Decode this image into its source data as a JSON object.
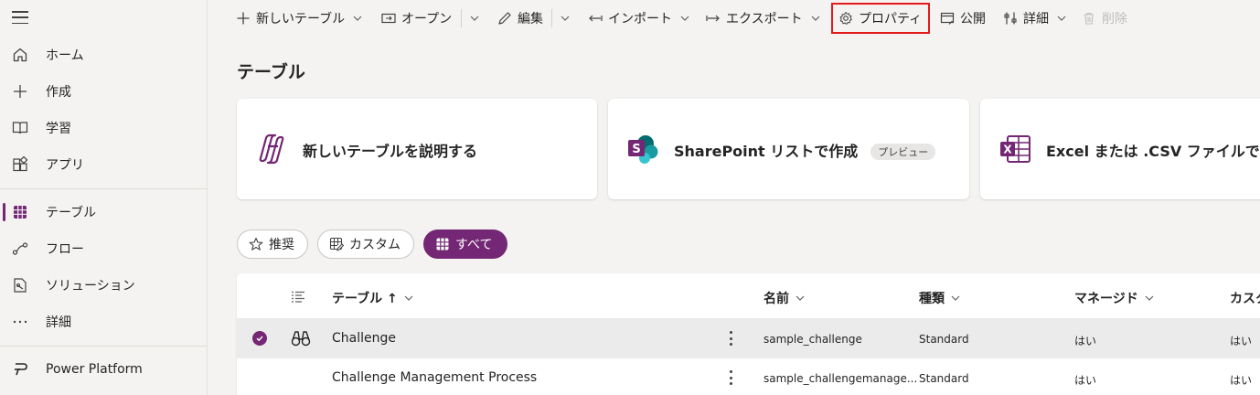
{
  "sidebar": {
    "menu_icon": "hamburger-icon",
    "items": [
      {
        "label": "ホーム",
        "icon": "home-icon"
      },
      {
        "label": "作成",
        "icon": "plus-icon"
      },
      {
        "label": "学習",
        "icon": "book-icon"
      },
      {
        "label": "アプリ",
        "icon": "apps-icon"
      },
      {
        "label": "テーブル",
        "icon": "table-icon",
        "active": true
      },
      {
        "label": "フロー",
        "icon": "flow-icon"
      },
      {
        "label": "ソリューション",
        "icon": "solution-icon"
      },
      {
        "label": "詳細",
        "icon": "more-icon"
      },
      {
        "label": "Power Platform",
        "icon": "power-platform-icon"
      }
    ]
  },
  "toolbar": {
    "new_table": "新しいテーブル",
    "open": "オープン",
    "edit": "編集",
    "import": "インポート",
    "export": "エクスポート",
    "properties": "プロパティ",
    "publish": "公開",
    "details": "詳細",
    "delete": "削除"
  },
  "page": {
    "title": "テーブル"
  },
  "cards": [
    {
      "label": "新しいテーブルを説明する",
      "icon": "copilot-icon"
    },
    {
      "label": "SharePoint リストで作成",
      "badge": "プレビュー",
      "icon": "sharepoint-icon"
    },
    {
      "label": "Excel または .CSV ファイルで作成",
      "icon": "excel-icon"
    }
  ],
  "filters": {
    "recommended": "推奨",
    "custom": "カスタム",
    "all": "すべて",
    "selected": "all"
  },
  "grid": {
    "columns": {
      "table": "テーブル ↑",
      "name": "名前",
      "type": "種類",
      "managed": "マネージド",
      "custom": "カスタ"
    },
    "rows": [
      {
        "table": "Challenge",
        "name": "sample_challenge",
        "type": "Standard",
        "managed": "はい",
        "custom": "はい",
        "selected": true
      },
      {
        "table": "Challenge Management Process",
        "name": "sample_challengemanage...",
        "type": "Standard",
        "managed": "はい",
        "custom": "はい",
        "selected": false
      }
    ]
  },
  "colors": {
    "accent": "#742774",
    "highlight": "#e21b1b"
  }
}
